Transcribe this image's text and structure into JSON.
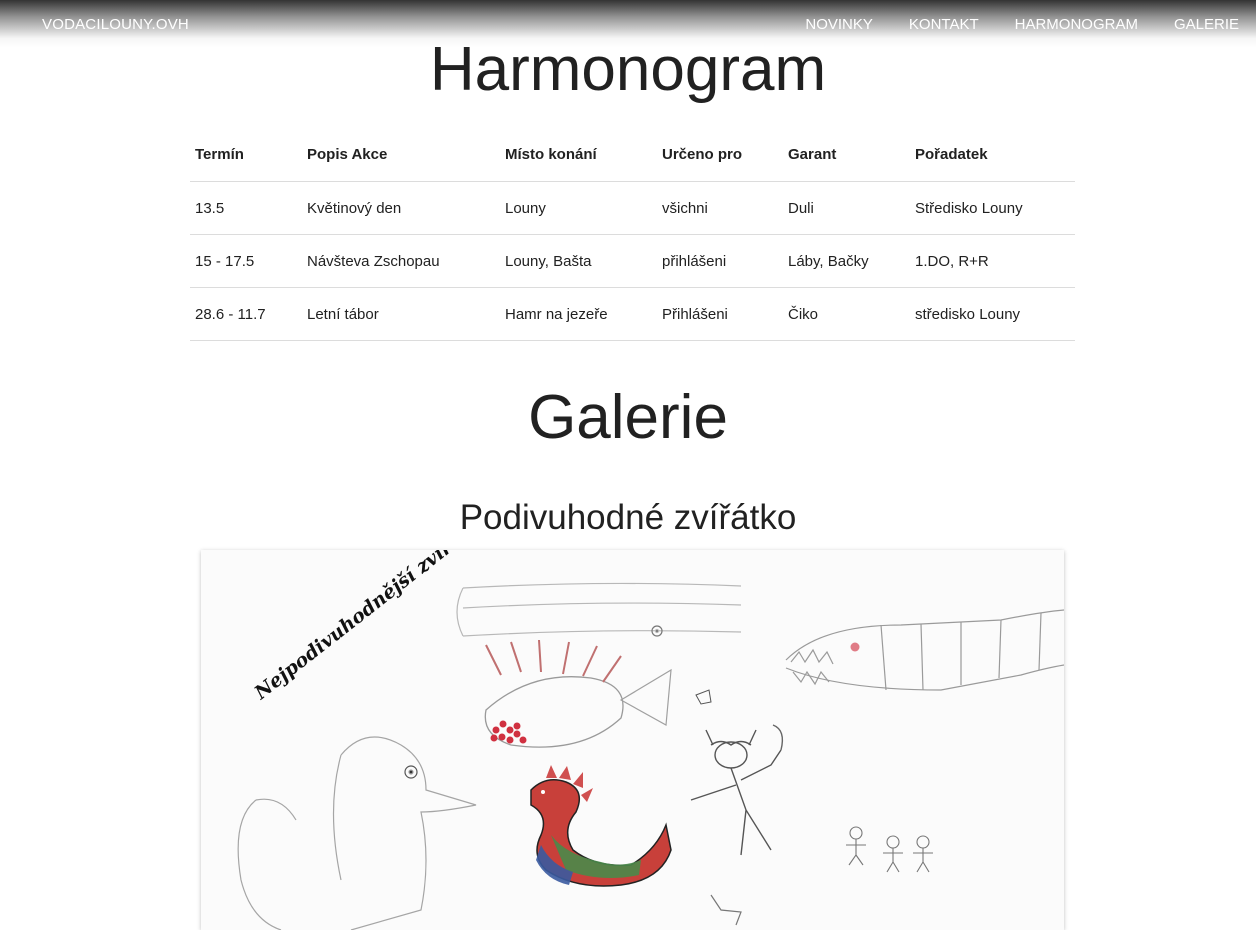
{
  "navbar": {
    "brand": "VODACILOUNY.OVH",
    "links": [
      "NOVINKY",
      "KONTAKT",
      "HARMONOGRAM",
      "GALERIE"
    ]
  },
  "harmonogram": {
    "title": "Harmonogram",
    "headers": [
      "Termín",
      "Popis Akce",
      "Místo konání",
      "Určeno pro",
      "Garant",
      "Pořadatek"
    ],
    "rows": [
      [
        "13.5",
        "Květinový den",
        "Louny",
        "všichni",
        "Duli",
        "Středisko Louny"
      ],
      [
        "15 - 17.5",
        "Návšteva Zschopau",
        "Louny, Bašta",
        "přihlášeni",
        "Láby, Bačky",
        "1.DO, R+R"
      ],
      [
        "28.6 - 11.7",
        "Letní tábor",
        "Hamr na jezeře",
        "Přihlášeni",
        "Čiko",
        "středisko Louny"
      ]
    ]
  },
  "galerie": {
    "title": "Galerie",
    "album_title": "Podivuhodné zvířátko",
    "drawing_caption": "Nejpodivuhodnější zvíře"
  }
}
